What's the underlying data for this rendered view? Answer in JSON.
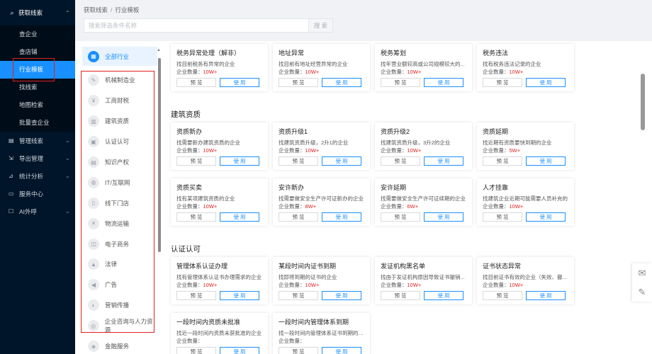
{
  "nav": {
    "group": {
      "icon": "search-icon",
      "label": "获取线索",
      "arrow": "⌃"
    },
    "sub_items": [
      {
        "label": "查企业",
        "active": false
      },
      {
        "label": "查店铺",
        "active": false
      },
      {
        "label": "行业模板",
        "active": true
      },
      {
        "label": "找线索",
        "active": false
      },
      {
        "label": "地图检索",
        "active": false
      },
      {
        "label": "批量查企业",
        "active": false
      }
    ],
    "items": [
      {
        "icon": "folder-icon",
        "glyph": "▤",
        "label": "管理线索",
        "arrow": "⌄"
      },
      {
        "icon": "export-icon",
        "glyph": "⇲",
        "label": "导出管理",
        "arrow": "⌄"
      },
      {
        "icon": "chart-icon",
        "glyph": "⊿",
        "label": "统计分析",
        "arrow": "⌄"
      },
      {
        "icon": "service-icon",
        "glyph": "▭",
        "label": "服务中心",
        "arrow": ""
      },
      {
        "icon": "phone-icon",
        "glyph": "☐",
        "label": "AI外呼",
        "arrow": "⌄"
      }
    ]
  },
  "breadcrumb": {
    "parent": "获取线索",
    "separator": "/",
    "current": "行业模板"
  },
  "search": {
    "placeholder": "搜索筛选条件名称",
    "button": "搜 索"
  },
  "categories": [
    {
      "label": "全部行业",
      "icon": "grid-icon",
      "glyph": "▦",
      "active": true
    },
    {
      "label": "机械制造业",
      "icon": "wrench-icon",
      "glyph": "✎"
    },
    {
      "label": "工商财税",
      "icon": "yen-icon",
      "glyph": "¥"
    },
    {
      "label": "建筑资质",
      "icon": "building-icon",
      "glyph": "▥"
    },
    {
      "label": "认证认可",
      "icon": "certificate-icon",
      "glyph": "▣"
    },
    {
      "label": "知识产权",
      "icon": "document-icon",
      "glyph": "▤"
    },
    {
      "label": "IT/互联网",
      "icon": "globe-icon",
      "glyph": "◍"
    },
    {
      "label": "线下门店",
      "icon": "store-icon",
      "glyph": "▯"
    },
    {
      "label": "物流运输",
      "icon": "truck-icon",
      "glyph": "✕"
    },
    {
      "label": "电子商务",
      "icon": "cart-icon",
      "glyph": "◫"
    },
    {
      "label": "法律",
      "icon": "scale-icon",
      "glyph": "▲"
    },
    {
      "label": "广告",
      "icon": "megaphone-icon",
      "glyph": "◀"
    },
    {
      "label": "营销传播",
      "icon": "broadcast-icon",
      "glyph": "◐"
    },
    {
      "label": "企业咨询与人力资源",
      "icon": "people-icon",
      "glyph": "◎"
    },
    {
      "label": "金融服务",
      "icon": "bank-icon",
      "glyph": "◈"
    }
  ],
  "labels": {
    "count_prefix": "企业数量：",
    "preview": "预 览",
    "use": "使 用"
  },
  "sections": [
    {
      "title": "",
      "cards": [
        {
          "title": "税务异常处理（解非）",
          "desc": "找目前税务有异常的企业",
          "count": "10W+"
        },
        {
          "title": "地址异常",
          "desc": "找目前有地址经营异常的企业",
          "count": "10W+"
        },
        {
          "title": "税务筹划",
          "desc": "找年营业额较高或公司规模较大的...",
          "count": "10W+"
        },
        {
          "title": "税务违法",
          "desc": "找有税务违法记录的企业",
          "count": "10W+"
        }
      ]
    },
    {
      "title": "建筑资质",
      "cards": [
        {
          "title": "资质新办",
          "desc": "找需要新办建筑资质的企业",
          "count": "10W+"
        },
        {
          "title": "资质升级1",
          "desc": "找建筑资质升级，2升1的企业",
          "count": "10W+"
        },
        {
          "title": "资质升级2",
          "desc": "找建筑资质升级，3升2的企业",
          "count": "10W+"
        },
        {
          "title": "资质延期",
          "desc": "找近期有资质要快到期的企业",
          "count": "5W+"
        },
        {
          "title": "资质买卖",
          "desc": "找有某项建筑资质的企业",
          "count": "10W+"
        },
        {
          "title": "安许新办",
          "desc": "找需要做安全生产许可证新办的企业",
          "count": "8W+"
        },
        {
          "title": "安许延期",
          "desc": "找需要做安全生产许可证续期的企业",
          "count": "6W+"
        },
        {
          "title": "人才挂靠",
          "desc": "找建筑企业近期可能需要人员补充的",
          "count": "10W+"
        }
      ]
    },
    {
      "title": "认证认可",
      "cards": [
        {
          "title": "管理体系认证办理",
          "desc": "找有管理体系认证书办理需求的企业",
          "count": "10W+"
        },
        {
          "title": "某段时间内证书到期",
          "desc": "找即将到期的证书的企业",
          "count": "10W+"
        },
        {
          "title": "发证机构黑名单",
          "desc": "找由于发证机构原因导致证书撤销...",
          "count": "10W+"
        },
        {
          "title": "证书状态异常",
          "desc": "找目前证书有效的企业（失效、撤...",
          "count": "10W+"
        },
        {
          "title": "一段时间内资质未批准",
          "desc": "找近一段时间内资质未获批准的企业",
          "count": ""
        },
        {
          "title": "一段时间内管理体系到期",
          "desc": "找一段时间内管理体系证书到期的企业",
          "count": ""
        }
      ]
    }
  ],
  "float_tools": [
    {
      "icon": "message-icon",
      "glyph": "✉"
    },
    {
      "icon": "edit-icon",
      "glyph": "✎"
    }
  ]
}
